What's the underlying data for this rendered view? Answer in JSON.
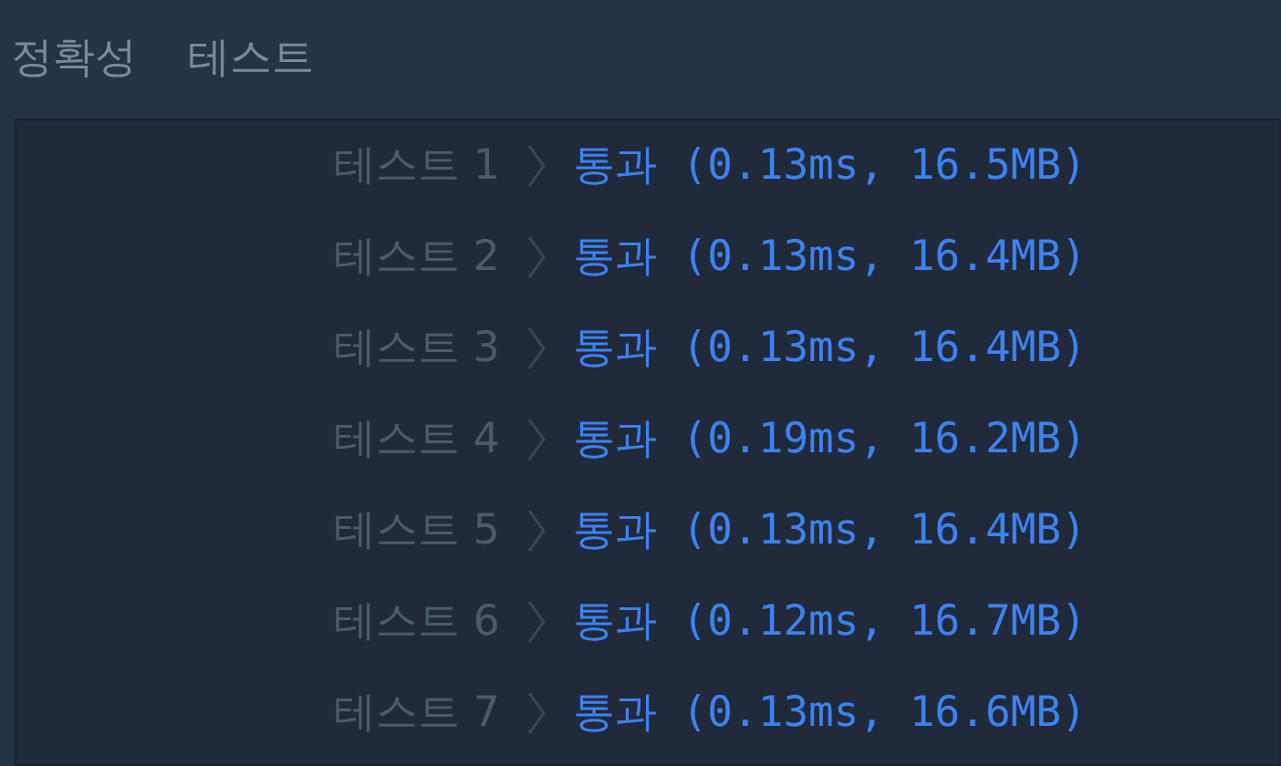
{
  "header": {
    "title": "정확성",
    "subtitle": "테스트"
  },
  "results": [
    {
      "label": "테스트 1",
      "result": "통과 (0.13ms, 16.5MB)"
    },
    {
      "label": "테스트 2",
      "result": "통과 (0.13ms, 16.4MB)"
    },
    {
      "label": "테스트 3",
      "result": "통과 (0.13ms, 16.4MB)"
    },
    {
      "label": "테스트 4",
      "result": "통과 (0.19ms, 16.2MB)"
    },
    {
      "label": "테스트 5",
      "result": "통과 (0.13ms, 16.4MB)"
    },
    {
      "label": "테스트 6",
      "result": "통과 (0.12ms, 16.7MB)"
    },
    {
      "label": "테스트 7",
      "result": "통과 (0.13ms, 16.6MB)"
    }
  ]
}
